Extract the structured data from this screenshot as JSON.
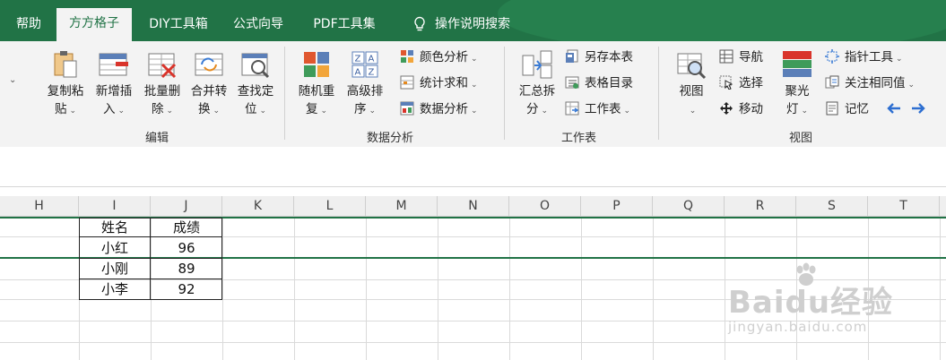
{
  "tabs": [
    {
      "label": "帮助",
      "active": false
    },
    {
      "label": "方方格子",
      "active": true
    },
    {
      "label": "DIY工具箱",
      "active": false
    },
    {
      "label": "公式向导",
      "active": false
    },
    {
      "label": "PDF工具集",
      "active": false
    },
    {
      "label": "操作说明搜索",
      "active": false,
      "icon": "lightbulb-icon"
    }
  ],
  "ribbon": {
    "edit": {
      "buttons": [
        {
          "line1": "复制粘",
          "line2": "贴"
        },
        {
          "line1": "新增插",
          "line2": "入"
        },
        {
          "line1": "批量删",
          "line2": "除"
        },
        {
          "line1": "合并转",
          "line2": "换"
        },
        {
          "line1": "查找定",
          "line2": "位"
        }
      ],
      "label": "编辑"
    },
    "analysis": {
      "buttons": [
        {
          "line1": "随机重",
          "line2": "复"
        },
        {
          "line1": "高级排",
          "line2": "序"
        }
      ],
      "small": [
        "颜色分析",
        "统计求和",
        "数据分析"
      ],
      "label": "数据分析"
    },
    "sheet": {
      "big": {
        "line1": "汇总拆",
        "line2": "分"
      },
      "small": [
        "另存本表",
        "表格目录",
        "工作表"
      ],
      "label": "工作表"
    },
    "view": {
      "view_btn": "视图",
      "small1": [
        "导航",
        "选择",
        "移动"
      ],
      "focus": {
        "line1": "聚光",
        "line2": "灯"
      },
      "small2": [
        "指针工具",
        "关注相同值",
        "记忆"
      ],
      "label": "视图"
    }
  },
  "columns": [
    "H",
    "I",
    "J",
    "K",
    "L",
    "M",
    "N",
    "O",
    "P",
    "Q",
    "R",
    "S",
    "T"
  ],
  "table": {
    "headers": [
      "姓名",
      "成绩"
    ],
    "rows": [
      [
        "小红",
        "96"
      ],
      [
        "小刚",
        "89"
      ],
      [
        "小李",
        "92"
      ]
    ]
  },
  "watermark": {
    "brand": "Baidu经验",
    "url": "jingyan.baidu.com"
  },
  "colors": {
    "accent": "#217346",
    "arrows": "#2e6fd1"
  }
}
